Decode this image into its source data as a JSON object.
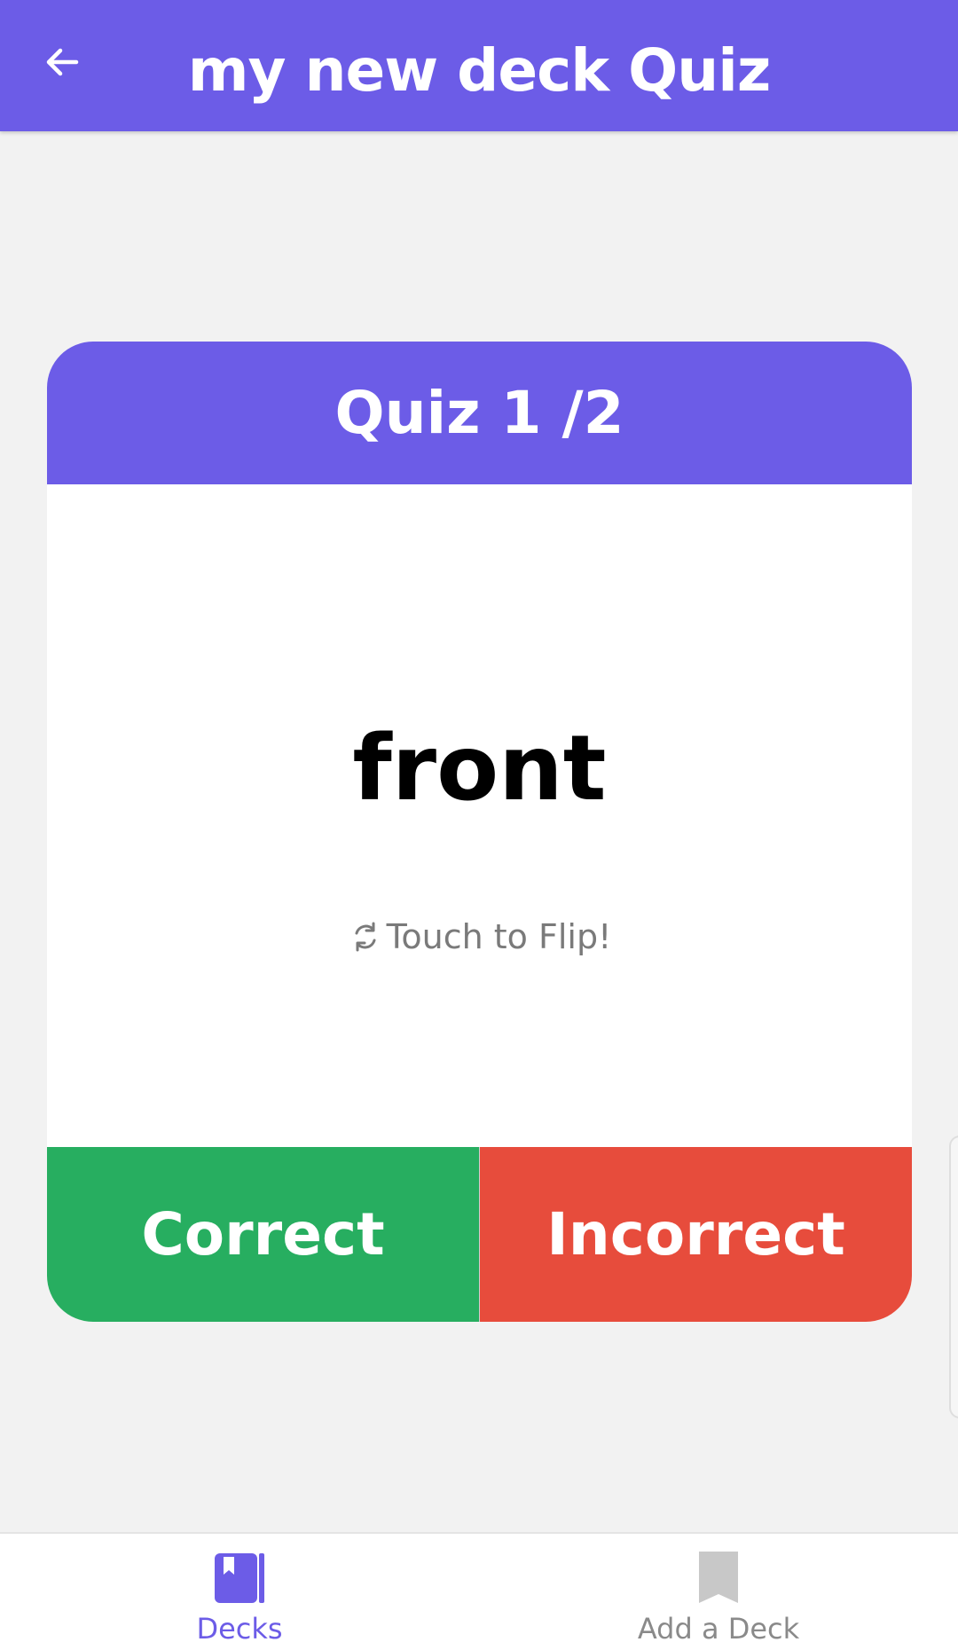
{
  "header": {
    "title": "my new deck Quiz",
    "back_icon": "arrow-left-icon"
  },
  "card": {
    "progress_title": "Quiz 1 /2",
    "front_text": "front",
    "flip_hint": "Touch to Flip!",
    "flip_icon": "refresh-icon"
  },
  "actions": {
    "correct_label": "Correct",
    "incorrect_label": "Incorrect"
  },
  "bottom_nav": {
    "items": [
      {
        "label": "Decks",
        "icon": "book-icon",
        "active": true
      },
      {
        "label": "Add a Deck",
        "icon": "bookmark-icon",
        "active": false
      }
    ]
  },
  "colors": {
    "primary": "#6c5ce7",
    "correct": "#27ae60",
    "incorrect": "#e74c3c",
    "background": "#f2f2f2",
    "inactive": "#c8c8c8"
  }
}
